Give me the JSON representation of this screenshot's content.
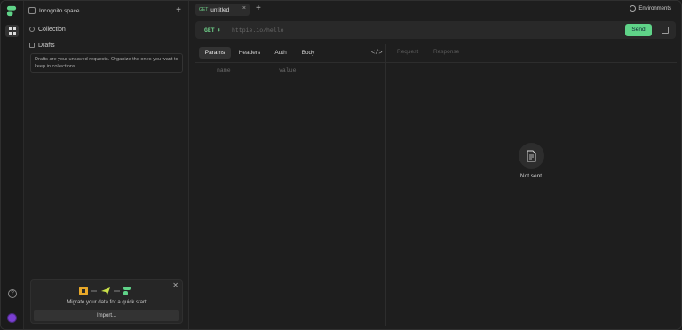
{
  "app": {
    "accent": "#5fd388",
    "avatar_color": "#7a3fd1"
  },
  "rail": {
    "icons": [
      "logo-icon",
      "apps-grid-icon",
      "help-icon",
      "user-avatar"
    ]
  },
  "sidebar": {
    "space_label": "Incognito space",
    "items": [
      {
        "label": "Collection",
        "icon": "collection-icon"
      },
      {
        "label": "Drafts",
        "icon": "drafts-icon"
      }
    ],
    "drafts_hint": "Drafts are your unsaved requests. Organize the ones you want to keep in collections.",
    "migrate": {
      "text": "Migrate your data for a quick start",
      "import_label": "Import..."
    }
  },
  "tabs": [
    {
      "method": "GET",
      "label": "untitled"
    }
  ],
  "header": {
    "environments_label": "Environments"
  },
  "request": {
    "method": "GET",
    "url_placeholder": "httpie.io/hello",
    "send_label": "Send",
    "subtabs": [
      "Params",
      "Headers",
      "Auth",
      "Body"
    ],
    "active_subtab": "Params",
    "params_columns": [
      "name",
      "value"
    ]
  },
  "response": {
    "tabs": [
      "Request",
      "Response"
    ],
    "empty_label": "Not sent"
  }
}
